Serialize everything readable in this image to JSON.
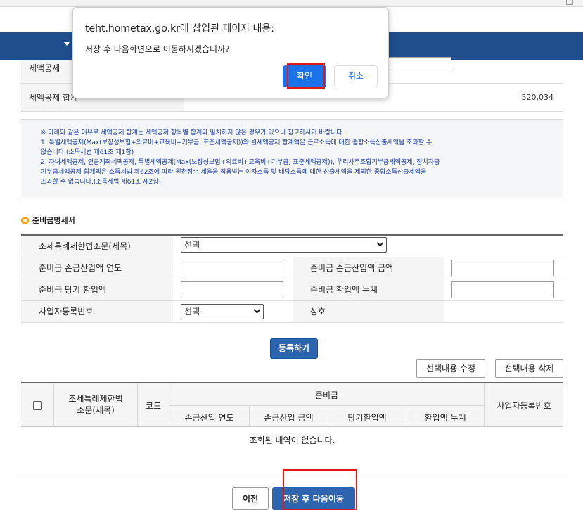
{
  "summary": {
    "row1_label": "세액공제",
    "row2_label": "세액공제 합계",
    "row2_value": "520,034"
  },
  "notice": {
    "line1": "※ 아래와 같은 이유로 세액공제 합계는 세액공제 항목별 합계와 일치하지 않은 경우가 있으니 참고하시기 바랍니다.",
    "line2": "1. 특별세액공제(Max(보장성보험+의료비+교육비+기부금, 표준세액공제))와 월세액공제 합계액은 근로소득에 대한 종합소득산출세액을 초과할 수",
    "line3": "없습니다.(소득세법 제61조 제1항)",
    "line4": "2. 자녀세액공제, 연금계좌세액공제, 특별세액공제(Max(보장성보험+의료비+교육비+기부금, 표준세액공제)), 우리사주조합기부금세액공제, 정치자금",
    "line5": "기부금세액공제 합계액은 소득세법 제62조에 따라 원천징수 세율을 적용받는 이자소득 및 배당소득에 대한 산출세액을 제외한 종합소득산출세액을",
    "line6": "초과할 수 없습니다.(소득세법 제61조 제2항)"
  },
  "section": {
    "title": "준비금명세서"
  },
  "form": {
    "law_label": "조세특례제한법조문(제목)",
    "law_select": "선택",
    "year_label": "준비금 손금산입액 연도",
    "amount_label": "준비금 손금산입액 금액",
    "current_label": "준비금 당기 환입액",
    "cumulative_label": "준비금 환입액 누계",
    "bizno_label": "사업자등록번호",
    "bizno_select": "선택",
    "company_label": "상호"
  },
  "buttons": {
    "register": "등록하기",
    "edit_selected": "선택내용 수정",
    "delete_selected": "선택내용 삭제",
    "prev": "이전",
    "save_next": "저장 후 다음이동"
  },
  "result_table": {
    "col_law_line1": "조세특례제한법",
    "col_law_line2": "조문(제목)",
    "col_code": "코드",
    "col_reserve": "준비금",
    "col_year": "손금산입 연도",
    "col_amount": "손금산입 금액",
    "col_current": "당기환입액",
    "col_cumulative": "환입액 누계",
    "col_bizno": "사업자등록번호",
    "empty_message": "조회된 내역이 없습니다."
  },
  "dialog": {
    "title": "teht.hometax.go.kr에 삽입된 페이지 내용:",
    "message": "저장 후 다음화면으로 이동하시겠습니까?",
    "ok": "확인",
    "cancel": "취소"
  },
  "colors": {
    "nav_blue": "#1f4e8c",
    "button_blue": "#2c64ad",
    "dialog_blue": "#1a73e8",
    "highlight_red": "#e01818",
    "notice_text": "#1a3e9c"
  }
}
